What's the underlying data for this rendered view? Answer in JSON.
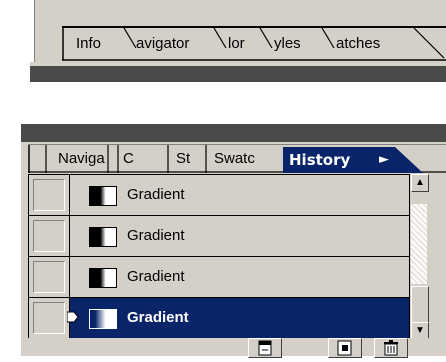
{
  "top_panel": {
    "tabs": [
      {
        "label": "Info"
      },
      {
        "label": "Navigator"
      },
      {
        "label": "Color"
      },
      {
        "label": "Styles"
      },
      {
        "label": "Swatches"
      }
    ],
    "visible_labels": [
      "Info",
      "avigator",
      "lor",
      "yles",
      "atches"
    ]
  },
  "history_panel": {
    "tabs": [
      "Naviga",
      "C",
      "St",
      "Swatc"
    ],
    "active_tab": "History",
    "active_tab_arrow": "►",
    "items": [
      {
        "label": "Gradient",
        "selected": false,
        "icon": "gradient-icon"
      },
      {
        "label": "Gradient",
        "selected": false,
        "icon": "gradient-icon"
      },
      {
        "label": "Gradient",
        "selected": false,
        "icon": "gradient-icon"
      },
      {
        "label": "Gradient",
        "selected": true,
        "icon": "gradient-icon"
      }
    ],
    "scroll_up": "▲",
    "scroll_down": "▼",
    "buttons": [
      {
        "icon": "new-document-from-state-icon"
      },
      {
        "icon": "new-snapshot-icon"
      },
      {
        "icon": "trash-icon"
      }
    ]
  },
  "colors": {
    "panel_bg": "#d4d0c8",
    "selection": "#0a246a",
    "dark_bar": "#4a4a4a"
  }
}
